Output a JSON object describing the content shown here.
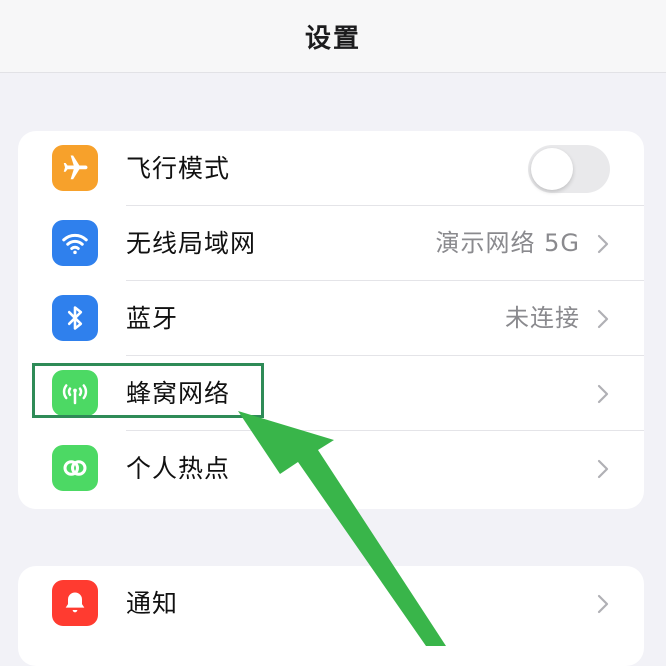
{
  "header": {
    "title": "设置"
  },
  "settings": {
    "airplane": {
      "label": "飞行模式",
      "toggle_on": false,
      "icon": "airplane-icon",
      "color": "#f7a12b"
    },
    "wifi": {
      "label": "无线局域网",
      "value": "演示网络 5G",
      "icon": "wifi-icon",
      "color": "#2f80ed"
    },
    "bluetooth": {
      "label": "蓝牙",
      "value": "未连接",
      "icon": "bluetooth-icon",
      "color": "#2f80ed"
    },
    "cellular": {
      "label": "蜂窝网络",
      "icon": "antenna-icon",
      "color": "#4cd964"
    },
    "hotspot": {
      "label": "个人热点",
      "icon": "link-icon",
      "color": "#4cd964"
    },
    "notifications": {
      "label": "通知",
      "icon": "bell-icon",
      "color": "#ff3b30"
    }
  },
  "annotation": {
    "highlight_color": "#2e8b57",
    "arrow_color": "#39b54a"
  }
}
